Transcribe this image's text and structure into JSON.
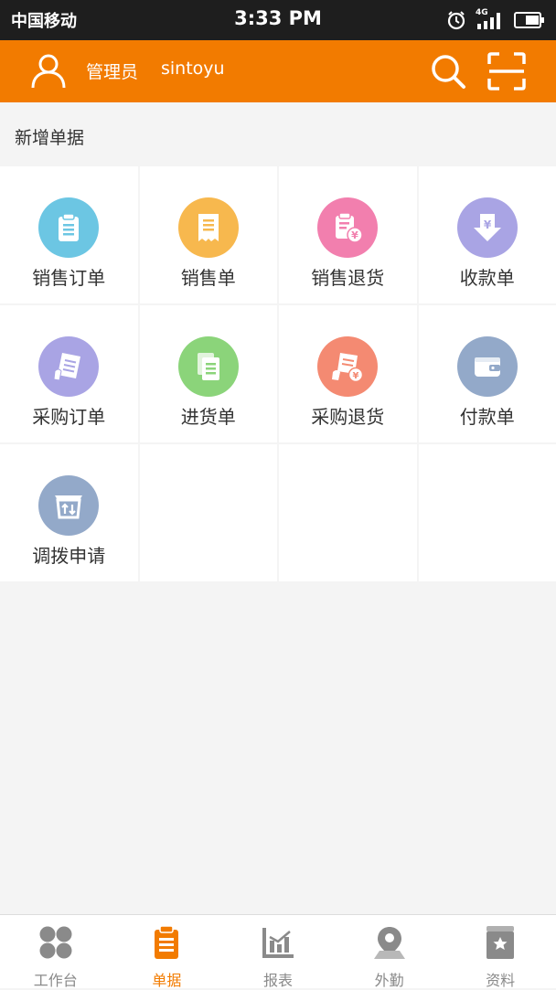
{
  "status_bar": {
    "carrier": "中国移动",
    "time": "3:33 PM",
    "network": "4G"
  },
  "header": {
    "role": "管理员",
    "username": "sintoyu",
    "icons": [
      "user-icon",
      "search-icon",
      "scan-icon"
    ],
    "background": "#f27b00"
  },
  "section": {
    "title": "新增单据"
  },
  "grid": {
    "items": [
      {
        "label": "销售订单",
        "icon": "clipboard-icon",
        "color": "#6cc6e3"
      },
      {
        "label": "销售单",
        "icon": "receipt-icon",
        "color": "#f7b84e"
      },
      {
        "label": "销售退货",
        "icon": "return-yen-icon",
        "color": "#f27fae"
      },
      {
        "label": "收款单",
        "icon": "download-yen-icon",
        "color": "#a9a4e4"
      },
      {
        "label": "采购订单",
        "icon": "purchase-order-icon",
        "color": "#a9a4e4"
      },
      {
        "label": "进货单",
        "icon": "documents-icon",
        "color": "#8bd47a"
      },
      {
        "label": "采购退货",
        "icon": "purchase-return-icon",
        "color": "#f48a72"
      },
      {
        "label": "付款单",
        "icon": "wallet-icon",
        "color": "#93a9c9"
      },
      {
        "label": "调拨申请",
        "icon": "transfer-box-icon",
        "color": "#93a9c9"
      }
    ]
  },
  "tabbar": {
    "tabs": [
      {
        "label": "工作台",
        "icon": "dashboard-icon"
      },
      {
        "label": "单据",
        "icon": "document-icon",
        "active": true
      },
      {
        "label": "报表",
        "icon": "report-chart-icon"
      },
      {
        "label": "外勤",
        "icon": "location-pin-icon"
      },
      {
        "label": "资料",
        "icon": "data-book-icon"
      }
    ],
    "active_color": "#f27b00",
    "inactive_color": "#8a8a8a"
  }
}
